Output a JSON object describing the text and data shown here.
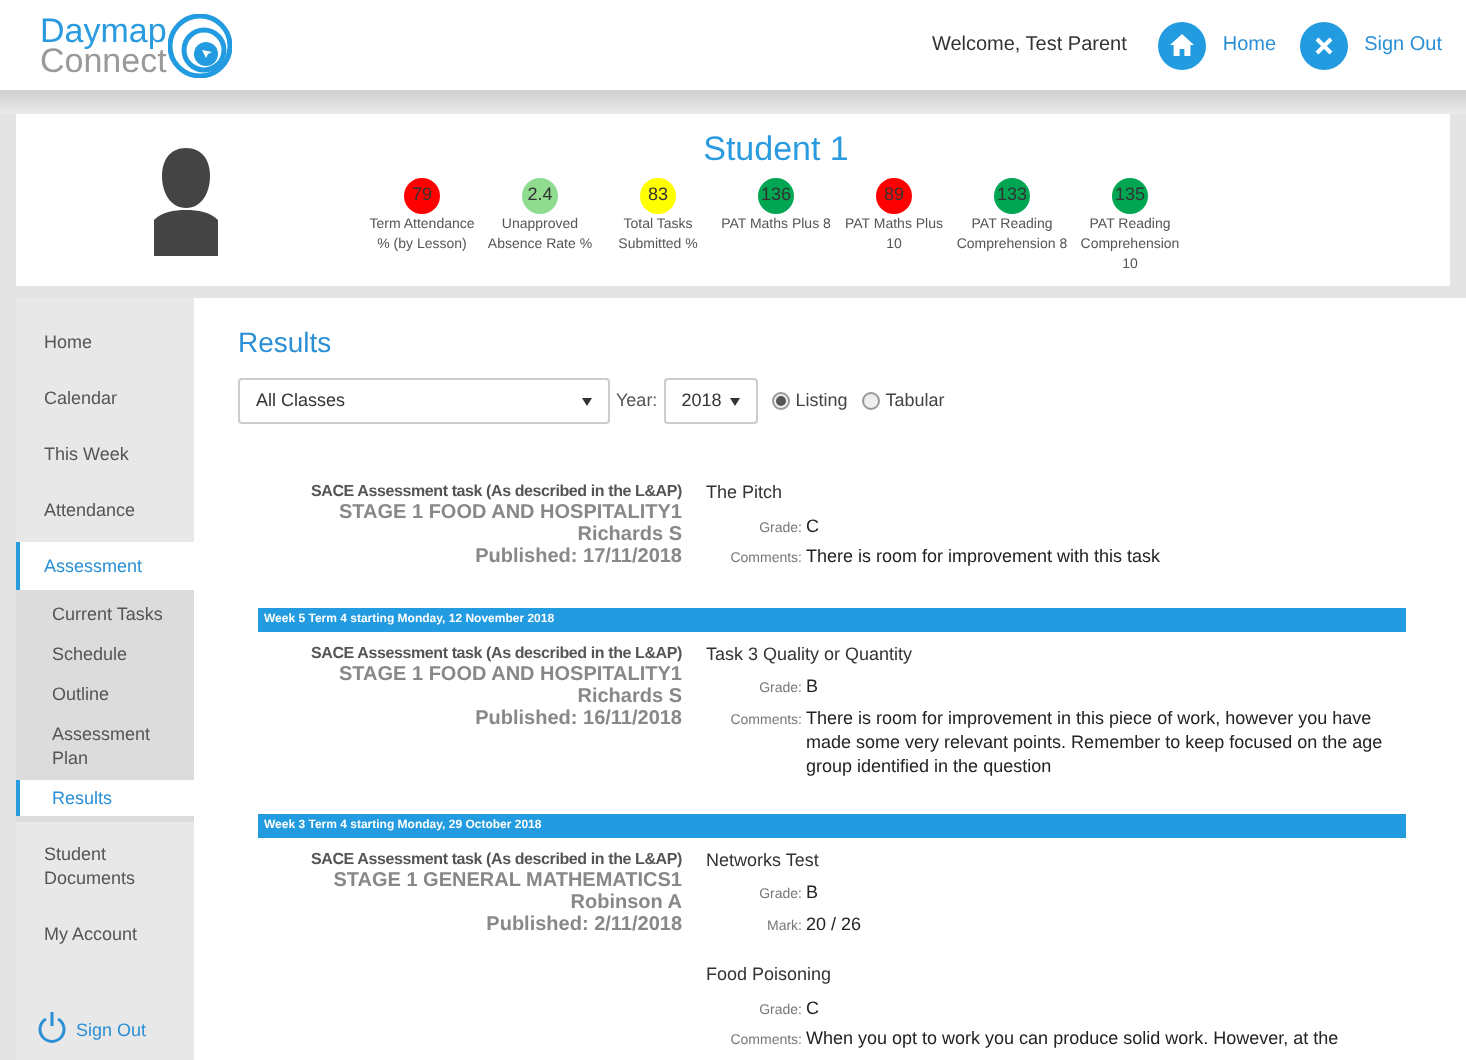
{
  "header": {
    "logo_top": "Daymap",
    "logo_bottom": "Connect",
    "welcome": "Welcome, Test Parent",
    "links": [
      {
        "kind": "home",
        "label": "Home"
      },
      {
        "kind": "close",
        "label": "Sign Out"
      }
    ]
  },
  "profile": {
    "name": "Student 1",
    "metrics": [
      {
        "value": "79",
        "color": "#ff0000",
        "label": "Term Attendance % (by Lesson)"
      },
      {
        "value": "2.4",
        "color": "#8fdc8f",
        "label": "Unapproved Absence Rate %"
      },
      {
        "value": "83",
        "color": "#ffff00",
        "label": "Total Tasks Submitted %"
      },
      {
        "value": "136",
        "color": "#00a651",
        "label": "PAT Maths Plus 8"
      },
      {
        "value": "89",
        "color": "#ff0000",
        "label": "PAT Maths Plus 10"
      },
      {
        "value": "133",
        "color": "#00a651",
        "label": "PAT Reading Comprehension 8"
      },
      {
        "value": "135",
        "color": "#00a651",
        "label": "PAT Reading Comprehension 10"
      }
    ]
  },
  "sidebar": {
    "items": [
      {
        "label": "Home",
        "selected": false
      },
      {
        "label": "Calendar",
        "selected": false
      },
      {
        "label": "This Week",
        "selected": false
      },
      {
        "label": "Attendance",
        "selected": false
      },
      {
        "label": "Assessment",
        "selected": true,
        "children": [
          {
            "label": "Current Tasks",
            "selected": false
          },
          {
            "label": "Schedule",
            "selected": false
          },
          {
            "label": "Outline",
            "selected": false
          },
          {
            "label": "Assessment Plan",
            "selected": false
          },
          {
            "label": "Results",
            "selected": true
          }
        ]
      },
      {
        "label": "Student Documents",
        "selected": false
      },
      {
        "label": "My Account",
        "selected": false
      }
    ],
    "sign_out": "Sign Out"
  },
  "results": {
    "title": "Results",
    "class_select": "All Classes",
    "year_label": "Year:",
    "year_select": "2018",
    "views": [
      {
        "label": "Listing",
        "selected": true
      },
      {
        "label": "Tabular",
        "selected": false
      }
    ],
    "sections": [
      {
        "entries": [
          {
            "type": "SACE Assessment task (As described in the L&AP)",
            "class": "STAGE 1 FOOD AND HOSPITALITY1",
            "teacher": "Richards S",
            "published": "Published: 17/11/2018",
            "tasks": [
              {
                "title": "The Pitch",
                "fields": [
                  {
                    "label": "Grade:",
                    "value": "C"
                  },
                  {
                    "label": "Comments:",
                    "value": "There is room for improvement with this task"
                  }
                ]
              }
            ]
          }
        ]
      },
      {
        "week": "Week 5 Term 4 starting Monday, 12 November 2018",
        "entries": [
          {
            "type": "SACE Assessment task (As described in the L&AP)",
            "class": "STAGE 1 FOOD AND HOSPITALITY1",
            "teacher": "Richards S",
            "published": "Published: 16/11/2018",
            "tasks": [
              {
                "title": "Task 3 Quality or Quantity",
                "fields": [
                  {
                    "label": "Grade:",
                    "value": "B"
                  },
                  {
                    "label": "Comments:",
                    "value": "There is room for improvement in this piece of work, however you have made some very relevant points. Remember to keep focused on the age group identified in the question"
                  }
                ]
              }
            ]
          }
        ]
      },
      {
        "week": "Week 3 Term 4 starting Monday, 29 October 2018",
        "entries": [
          {
            "type": "SACE Assessment task (As described in the L&AP)",
            "class": "STAGE 1 GENERAL MATHEMATICS1",
            "teacher": "Robinson A",
            "published": "Published: 2/11/2018",
            "tasks": [
              {
                "title": "Networks Test",
                "fields": [
                  {
                    "label": "Grade:",
                    "value": "B"
                  },
                  {
                    "label": "Mark:",
                    "value": "20 / 26"
                  }
                ]
              },
              {
                "title": "Food Poisoning",
                "fields": [
                  {
                    "label": "Grade:",
                    "value": "C"
                  },
                  {
                    "label": "Comments:",
                    "value": "When you opt to work you can produce solid work. However, at the"
                  }
                ]
              }
            ]
          }
        ]
      }
    ]
  }
}
